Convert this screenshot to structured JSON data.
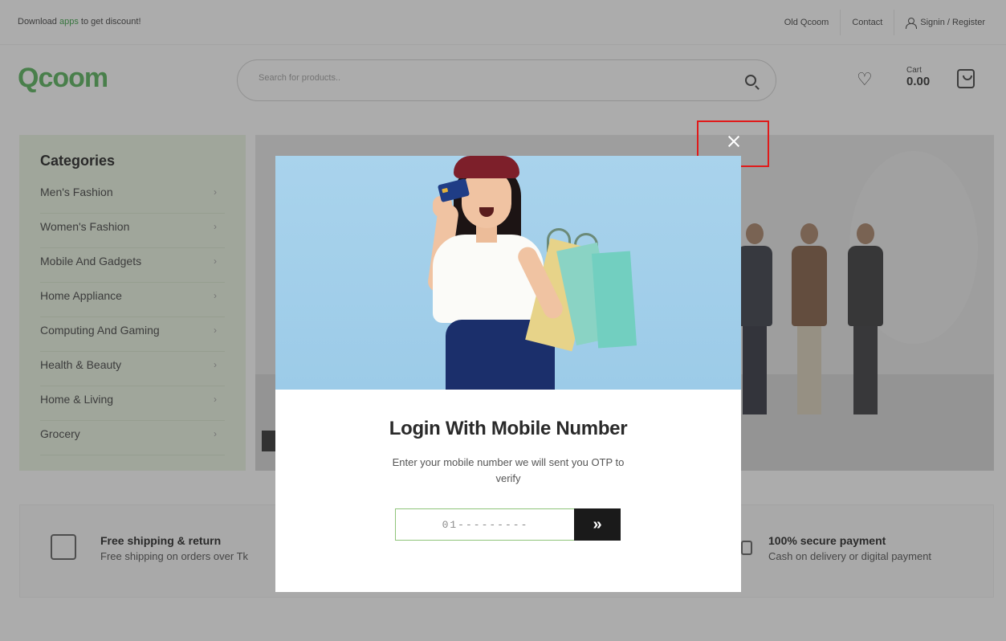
{
  "topbar": {
    "promo_prefix": "Download ",
    "promo_highlight": "apps",
    "promo_suffix": " to get discount!",
    "links": {
      "old": "Old Qcoom",
      "contact": "Contact",
      "auth": "Signin / Register"
    }
  },
  "header": {
    "logo": "Qcoom",
    "search_placeholder": "Search for products..",
    "cart_label": "Cart",
    "cart_amount": "0.00"
  },
  "categories": {
    "title": "Categories",
    "items": [
      "Men's Fashion",
      "Women's Fashion",
      "Mobile And Gadgets",
      "Home Appliance",
      "Computing And Gaming",
      "Health & Beauty",
      "Home & Living",
      "Grocery"
    ]
  },
  "features": [
    {
      "title": "Free shipping & return",
      "desc": "Free shipping on orders over Tk"
    },
    {
      "title": "100% secure payment",
      "desc": "Cash on delivery or digital payment"
    }
  ],
  "modal": {
    "title": "Login With Mobile Number",
    "subtitle": "Enter your mobile number we will sent you OTP to verify",
    "phone_placeholder": "01---------",
    "submit_label": "»"
  },
  "colors": {
    "brand_green": "#1f7a35",
    "highlight_red": "#e01a1a",
    "input_border": "#8fc47a",
    "submit_bg": "#1a1a1a"
  }
}
